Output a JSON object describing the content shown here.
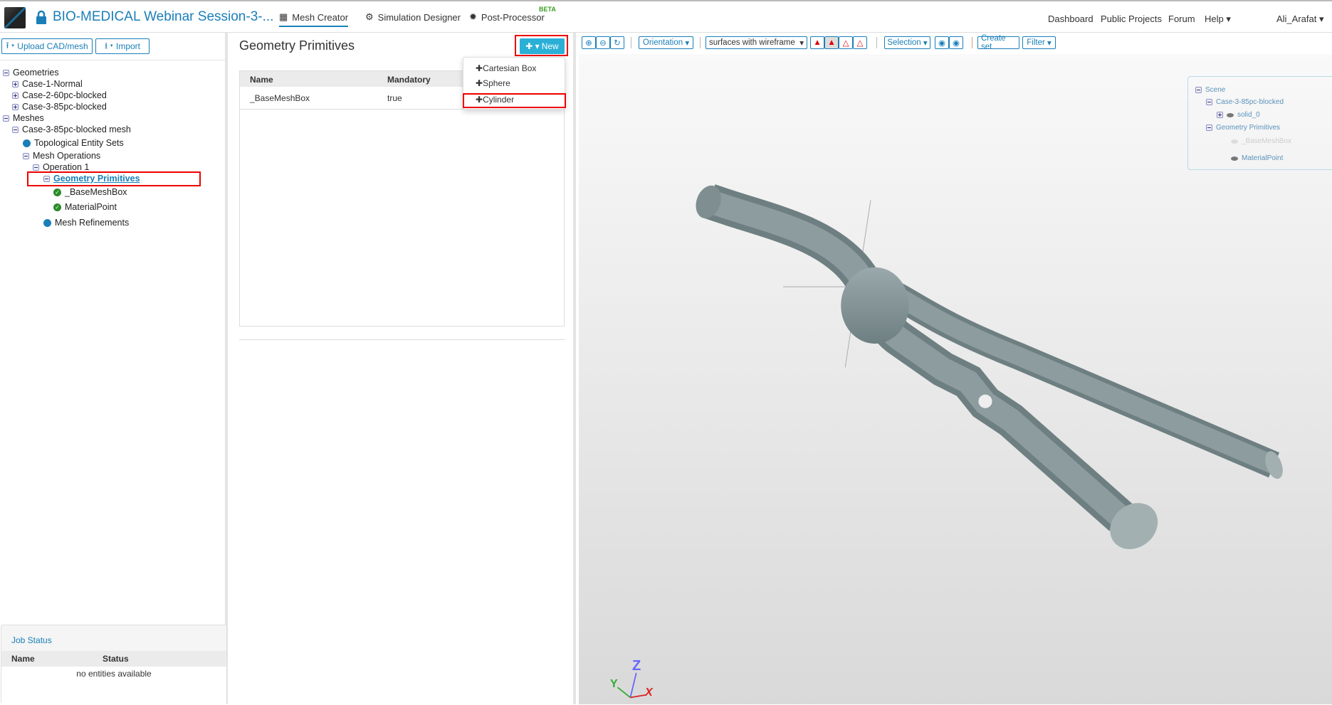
{
  "header": {
    "title": "BIO-MEDICAL Webinar Session-3-...",
    "tabs": [
      {
        "label": "Mesh Creator",
        "icon": "grid-icon",
        "active": true
      },
      {
        "label": "Simulation Designer",
        "icon": "gears-icon"
      },
      {
        "label": "Post-Processor",
        "icon": "cog-icon",
        "badge": "BETA"
      }
    ],
    "nav": [
      "Dashboard",
      "Public Projects",
      "Forum",
      "Help"
    ],
    "user": "Ali_Arafat"
  },
  "left": {
    "upload_label": "Upload CAD/mesh",
    "import_label": "Import",
    "tree": {
      "geometries": "Geometries",
      "geo_items": [
        "Case-1-Normal",
        "Case-2-60pc-blocked",
        "Case-3-85pc-blocked"
      ],
      "meshes": "Meshes",
      "mesh": "Case-3-85pc-blocked mesh",
      "tes": "Topological Entity Sets",
      "mesh_ops": "Mesh Operations",
      "op1": "Operation 1",
      "geo_prims": "Geometry Primitives",
      "prims": [
        "_BaseMeshBox",
        "MaterialPoint"
      ],
      "refinements": "Mesh Refinements"
    },
    "job_status": {
      "title": "Job Status",
      "col_name": "Name",
      "col_status": "Status",
      "empty": "no entities available"
    }
  },
  "mid": {
    "title": "Geometry Primitives",
    "new_label": "New",
    "table": {
      "headers": [
        "Name",
        "Mandatory"
      ],
      "rows": [
        [
          "_BaseMeshBox",
          "true"
        ]
      ]
    },
    "dropdown": [
      "Cartesian Box",
      "Sphere",
      "Cylinder"
    ]
  },
  "viewer": {
    "orientation": "Orientation",
    "render_mode": "surfaces with wireframe",
    "selection": "Selection",
    "create_set": "Create set",
    "filter": "Filter",
    "scene": {
      "root": "Scene",
      "geometry": "Case-3-85pc-blocked",
      "solid": "solid_0",
      "prims": "Geometry Primitives",
      "items": [
        "_BaseMeshBox",
        "MaterialPoint"
      ]
    },
    "axes": {
      "x": "X",
      "y": "Y",
      "z": "Z"
    },
    "colors": {
      "vessel": "#7f9093",
      "accent": "#1a7fb8",
      "highlight": "#e00000"
    }
  }
}
